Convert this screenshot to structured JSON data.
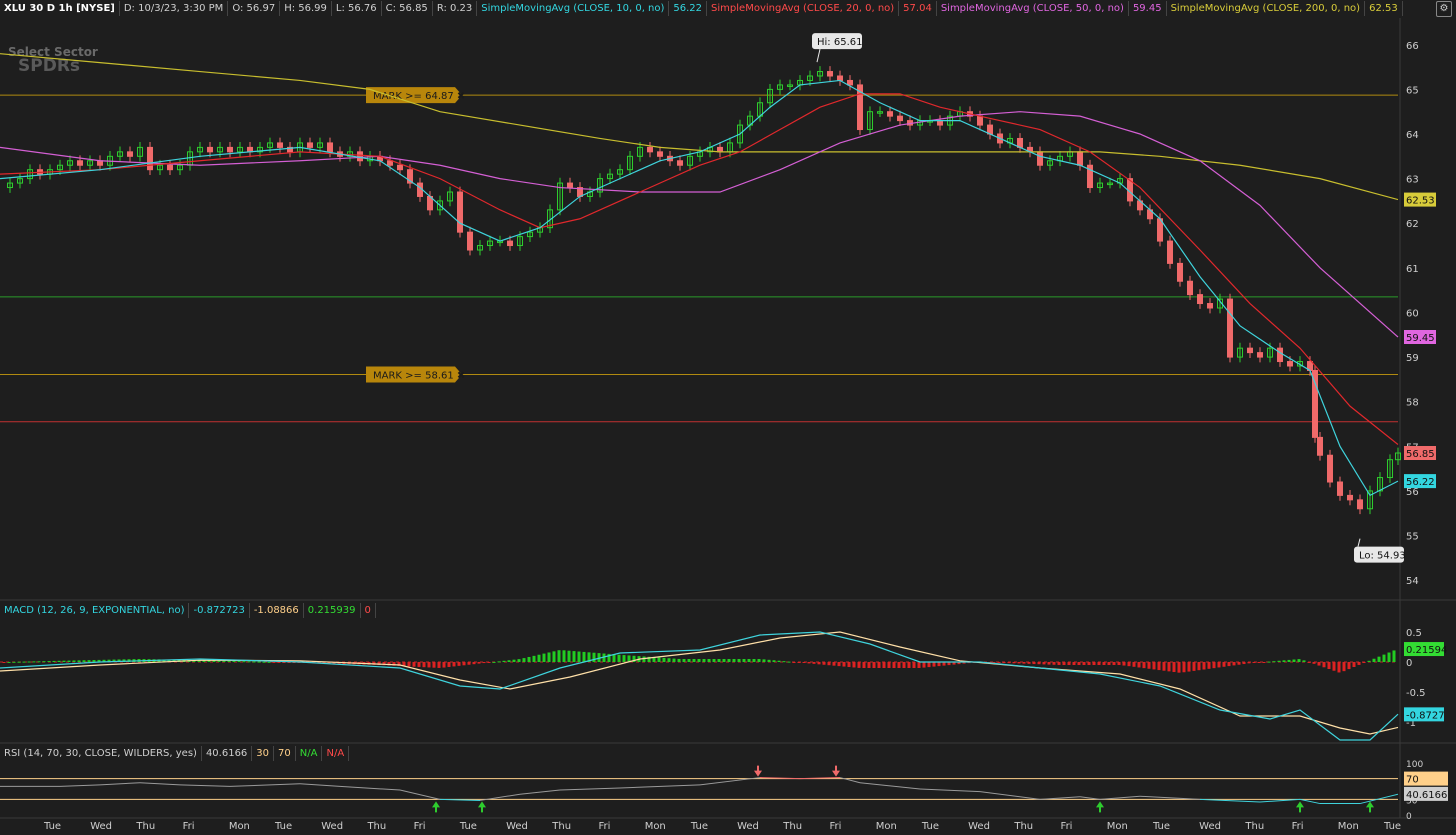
{
  "header": {
    "symbol": "XLU 30 D 1h [NYSE]",
    "date": "D: 10/3/23, 3:30 PM",
    "open": "O: 56.97",
    "high": "H: 56.99",
    "low": "L: 56.76",
    "close": "C: 56.85",
    "range": "R: 0.23",
    "sma10_label": "SimpleMovingAvg (CLOSE, 10, 0, no)",
    "sma10_value": "56.22",
    "sma20_label": "SimpleMovingAvg (CLOSE, 20, 0, no)",
    "sma20_value": "57.04",
    "sma50_label": "SimpleMovingAvg (CLOSE, 50, 0, no)",
    "sma50_value": "59.45",
    "sma200_label": "SimpleMovingAvg (CLOSE, 200, 0, no)",
    "sma200_value": "62.53"
  },
  "watermark": {
    "line1": "Select Sector",
    "line2": "SPDRs"
  },
  "marks": [
    {
      "label": "MARK >= 64.87 ✖",
      "price": 64.87
    },
    {
      "label": "MARK >= 58.61 ✖",
      "price": 58.61
    }
  ],
  "callouts": {
    "hi": "Hi: 65.61",
    "lo": "Lo: 54.93"
  },
  "macd_header": {
    "label": "MACD (12, 26, 9, EXPONENTIAL, no)",
    "value": "-0.872723",
    "avg": "-1.08866",
    "diff": "0.215939",
    "zero": "0"
  },
  "rsi_header": {
    "label": "RSI (14, 70, 30, CLOSE, WILDERS, yes)",
    "value": "40.6166",
    "os": "30",
    "ob": "70",
    "na1": "N/A",
    "na2": "N/A"
  },
  "colors": {
    "bg": "#1e1e1e",
    "up": "#2ecc2e",
    "down": "#f06a6a",
    "sma10": "#3fd3dc",
    "sma20": "#e0282c",
    "sma50": "#d45fd4",
    "sma200": "#c8be2e",
    "grid": "#2a2a2a"
  },
  "chart_data": {
    "type": "candlestick",
    "price_axis": {
      "range": [
        53.6,
        66.6
      ],
      "ticks": [
        54,
        55,
        56,
        57,
        58,
        59,
        60,
        61,
        62,
        63,
        64,
        65,
        66
      ]
    },
    "price_badges": [
      {
        "value": "62.53",
        "color": "#d8cc3a"
      },
      {
        "value": "59.45",
        "color": "#e066e0"
      },
      {
        "value": "56.85",
        "color": "#f06a6a"
      },
      {
        "value": "56.22",
        "color": "#33d6e0"
      }
    ],
    "horizontal_lines": [
      {
        "price": 60.35,
        "color": "#2a9a2a"
      },
      {
        "price": 57.55,
        "color": "#c03030"
      }
    ],
    "x_labels": [
      "Tue",
      "Wed",
      "Thu",
      "Fri",
      "Mon",
      "Tue",
      "Wed",
      "Thu",
      "Fri",
      "Tue",
      "Wed",
      "Thu",
      "Fri",
      "Mon",
      "Tue",
      "Wed",
      "Thu",
      "Fri",
      "Mon",
      "Tue",
      "Wed",
      "Thu",
      "Fri",
      "Mon",
      "Tue",
      "Wed",
      "Thu",
      "Fri",
      "Mon",
      "Tue"
    ],
    "close_path": [
      [
        0,
        62.8
      ],
      [
        10,
        62.9
      ],
      [
        20,
        63.0
      ],
      [
        30,
        63.2
      ],
      [
        40,
        63.1
      ],
      [
        50,
        63.2
      ],
      [
        60,
        63.3
      ],
      [
        70,
        63.4
      ],
      [
        80,
        63.3
      ],
      [
        90,
        63.4
      ],
      [
        100,
        63.3
      ],
      [
        110,
        63.5
      ],
      [
        120,
        63.6
      ],
      [
        130,
        63.5
      ],
      [
        140,
        63.7
      ],
      [
        150,
        63.2
      ],
      [
        160,
        63.3
      ],
      [
        170,
        63.2
      ],
      [
        180,
        63.3
      ],
      [
        190,
        63.6
      ],
      [
        200,
        63.7
      ],
      [
        210,
        63.6
      ],
      [
        220,
        63.7
      ],
      [
        230,
        63.6
      ],
      [
        240,
        63.7
      ],
      [
        250,
        63.6
      ],
      [
        260,
        63.7
      ],
      [
        270,
        63.8
      ],
      [
        280,
        63.7
      ],
      [
        290,
        63.6
      ],
      [
        300,
        63.8
      ],
      [
        310,
        63.7
      ],
      [
        320,
        63.8
      ],
      [
        330,
        63.6
      ],
      [
        340,
        63.5
      ],
      [
        350,
        63.6
      ],
      [
        360,
        63.4
      ],
      [
        370,
        63.5
      ],
      [
        380,
        63.4
      ],
      [
        390,
        63.3
      ],
      [
        400,
        63.2
      ],
      [
        410,
        62.9
      ],
      [
        420,
        62.6
      ],
      [
        430,
        62.3
      ],
      [
        440,
        62.5
      ],
      [
        450,
        62.7
      ],
      [
        460,
        61.8
      ],
      [
        470,
        61.4
      ],
      [
        480,
        61.5
      ],
      [
        490,
        61.6
      ],
      [
        500,
        61.6
      ],
      [
        510,
        61.5
      ],
      [
        520,
        61.7
      ],
      [
        530,
        61.8
      ],
      [
        540,
        61.9
      ],
      [
        550,
        62.3
      ],
      [
        560,
        62.9
      ],
      [
        570,
        62.8
      ],
      [
        580,
        62.6
      ],
      [
        590,
        62.7
      ],
      [
        600,
        63.0
      ],
      [
        610,
        63.1
      ],
      [
        620,
        63.2
      ],
      [
        630,
        63.5
      ],
      [
        640,
        63.7
      ],
      [
        650,
        63.6
      ],
      [
        660,
        63.5
      ],
      [
        670,
        63.4
      ],
      [
        680,
        63.3
      ],
      [
        690,
        63.5
      ],
      [
        700,
        63.6
      ],
      [
        710,
        63.7
      ],
      [
        720,
        63.6
      ],
      [
        730,
        63.8
      ],
      [
        740,
        64.2
      ],
      [
        750,
        64.4
      ],
      [
        760,
        64.7
      ],
      [
        770,
        65.0
      ],
      [
        780,
        65.1
      ],
      [
        790,
        65.1
      ],
      [
        800,
        65.2
      ],
      [
        810,
        65.3
      ],
      [
        820,
        65.4
      ],
      [
        830,
        65.3
      ],
      [
        840,
        65.2
      ],
      [
        850,
        65.1
      ],
      [
        860,
        64.1
      ],
      [
        870,
        64.5
      ],
      [
        880,
        64.5
      ],
      [
        890,
        64.4
      ],
      [
        900,
        64.3
      ],
      [
        910,
        64.2
      ],
      [
        920,
        64.3
      ],
      [
        930,
        64.3
      ],
      [
        940,
        64.2
      ],
      [
        950,
        64.4
      ],
      [
        960,
        64.5
      ],
      [
        970,
        64.4
      ],
      [
        980,
        64.2
      ],
      [
        990,
        64.0
      ],
      [
        1000,
        63.8
      ],
      [
        1010,
        63.9
      ],
      [
        1020,
        63.7
      ],
      [
        1030,
        63.6
      ],
      [
        1040,
        63.3
      ],
      [
        1050,
        63.4
      ],
      [
        1060,
        63.5
      ],
      [
        1070,
        63.6
      ],
      [
        1080,
        63.3
      ],
      [
        1090,
        62.8
      ],
      [
        1100,
        62.9
      ],
      [
        1110,
        62.9
      ],
      [
        1120,
        63.0
      ],
      [
        1130,
        62.5
      ],
      [
        1140,
        62.3
      ],
      [
        1150,
        62.1
      ],
      [
        1160,
        61.6
      ],
      [
        1170,
        61.1
      ],
      [
        1180,
        60.7
      ],
      [
        1190,
        60.4
      ],
      [
        1200,
        60.2
      ],
      [
        1210,
        60.1
      ],
      [
        1220,
        60.3
      ],
      [
        1230,
        59.0
      ],
      [
        1240,
        59.2
      ],
      [
        1250,
        59.1
      ],
      [
        1260,
        59.0
      ],
      [
        1270,
        59.2
      ],
      [
        1280,
        58.9
      ],
      [
        1290,
        58.8
      ],
      [
        1300,
        58.9
      ],
      [
        1310,
        58.7
      ],
      [
        1315,
        57.2
      ],
      [
        1320,
        56.8
      ],
      [
        1330,
        56.2
      ],
      [
        1340,
        55.9
      ],
      [
        1350,
        55.8
      ],
      [
        1360,
        55.6
      ],
      [
        1370,
        56.0
      ],
      [
        1380,
        56.3
      ],
      [
        1390,
        56.7
      ],
      [
        1398,
        56.85
      ]
    ],
    "sma10": [
      [
        0,
        63.0
      ],
      [
        100,
        63.2
      ],
      [
        200,
        63.5
      ],
      [
        300,
        63.7
      ],
      [
        380,
        63.4
      ],
      [
        420,
        62.8
      ],
      [
        460,
        62.0
      ],
      [
        500,
        61.6
      ],
      [
        540,
        61.9
      ],
      [
        580,
        62.6
      ],
      [
        620,
        63.0
      ],
      [
        660,
        63.4
      ],
      [
        700,
        63.6
      ],
      [
        740,
        64.0
      ],
      [
        770,
        64.6
      ],
      [
        800,
        65.1
      ],
      [
        840,
        65.2
      ],
      [
        880,
        64.7
      ],
      [
        920,
        64.3
      ],
      [
        960,
        64.3
      ],
      [
        1000,
        63.9
      ],
      [
        1040,
        63.5
      ],
      [
        1080,
        63.3
      ],
      [
        1120,
        62.9
      ],
      [
        1160,
        62.1
      ],
      [
        1200,
        60.8
      ],
      [
        1240,
        59.7
      ],
      [
        1280,
        59.1
      ],
      [
        1310,
        58.7
      ],
      [
        1340,
        57.0
      ],
      [
        1370,
        55.9
      ],
      [
        1398,
        56.22
      ]
    ],
    "sma20": [
      [
        0,
        63.1
      ],
      [
        100,
        63.2
      ],
      [
        200,
        63.4
      ],
      [
        300,
        63.6
      ],
      [
        380,
        63.5
      ],
      [
        440,
        63.0
      ],
      [
        500,
        62.3
      ],
      [
        540,
        61.9
      ],
      [
        580,
        62.1
      ],
      [
        640,
        62.7
      ],
      [
        700,
        63.3
      ],
      [
        740,
        63.6
      ],
      [
        780,
        64.1
      ],
      [
        820,
        64.6
      ],
      [
        860,
        64.9
      ],
      [
        900,
        64.9
      ],
      [
        940,
        64.6
      ],
      [
        980,
        64.4
      ],
      [
        1040,
        64.1
      ],
      [
        1090,
        63.6
      ],
      [
        1140,
        62.8
      ],
      [
        1200,
        61.4
      ],
      [
        1250,
        60.2
      ],
      [
        1300,
        59.2
      ],
      [
        1350,
        57.9
      ],
      [
        1398,
        57.04
      ]
    ],
    "sma50": [
      [
        0,
        63.7
      ],
      [
        100,
        63.4
      ],
      [
        200,
        63.3
      ],
      [
        300,
        63.4
      ],
      [
        380,
        63.5
      ],
      [
        440,
        63.3
      ],
      [
        500,
        63.0
      ],
      [
        560,
        62.8
      ],
      [
        640,
        62.7
      ],
      [
        720,
        62.7
      ],
      [
        780,
        63.2
      ],
      [
        840,
        63.8
      ],
      [
        900,
        64.2
      ],
      [
        960,
        64.4
      ],
      [
        1020,
        64.5
      ],
      [
        1080,
        64.4
      ],
      [
        1140,
        64.0
      ],
      [
        1200,
        63.4
      ],
      [
        1260,
        62.4
      ],
      [
        1320,
        61.0
      ],
      [
        1398,
        59.45
      ]
    ],
    "sma200": [
      [
        0,
        65.8
      ],
      [
        100,
        65.6
      ],
      [
        200,
        65.4
      ],
      [
        300,
        65.2
      ],
      [
        370,
        65.0
      ],
      [
        440,
        64.5
      ],
      [
        520,
        64.2
      ],
      [
        600,
        63.9
      ],
      [
        660,
        63.7
      ],
      [
        720,
        63.6
      ],
      [
        800,
        63.6
      ],
      [
        880,
        63.6
      ],
      [
        960,
        63.6
      ],
      [
        1040,
        63.6
      ],
      [
        1100,
        63.6
      ],
      [
        1160,
        63.5
      ],
      [
        1240,
        63.3
      ],
      [
        1320,
        63.0
      ],
      [
        1398,
        62.53
      ]
    ],
    "macd": {
      "range": [
        -1.3,
        0.7
      ],
      "ticks": [
        0.5,
        0,
        -0.5,
        -1
      ],
      "badges": [
        {
          "value": "0.21594",
          "color": "#33dd33"
        },
        {
          "value": "-0.8727",
          "color": "#33d6e0"
        }
      ],
      "value_line": [
        [
          0,
          -0.1
        ],
        [
          100,
          0.0
        ],
        [
          200,
          0.05
        ],
        [
          300,
          0.0
        ],
        [
          400,
          -0.1
        ],
        [
          460,
          -0.4
        ],
        [
          500,
          -0.45
        ],
        [
          560,
          -0.1
        ],
        [
          620,
          0.15
        ],
        [
          700,
          0.2
        ],
        [
          760,
          0.45
        ],
        [
          820,
          0.5
        ],
        [
          870,
          0.3
        ],
        [
          920,
          0.0
        ],
        [
          980,
          0.0
        ],
        [
          1040,
          -0.1
        ],
        [
          1100,
          -0.2
        ],
        [
          1160,
          -0.4
        ],
        [
          1220,
          -0.8
        ],
        [
          1270,
          -0.95
        ],
        [
          1300,
          -0.8
        ],
        [
          1340,
          -1.3
        ],
        [
          1370,
          -1.3
        ],
        [
          1398,
          -0.87
        ]
      ],
      "avg_line": [
        [
          0,
          -0.15
        ],
        [
          100,
          -0.05
        ],
        [
          200,
          0.03
        ],
        [
          300,
          0.02
        ],
        [
          400,
          -0.05
        ],
        [
          460,
          -0.3
        ],
        [
          510,
          -0.45
        ],
        [
          570,
          -0.25
        ],
        [
          640,
          0.05
        ],
        [
          720,
          0.2
        ],
        [
          780,
          0.4
        ],
        [
          840,
          0.5
        ],
        [
          900,
          0.25
        ],
        [
          960,
          0.02
        ],
        [
          1040,
          -0.1
        ],
        [
          1120,
          -0.2
        ],
        [
          1180,
          -0.45
        ],
        [
          1240,
          -0.9
        ],
        [
          1300,
          -0.9
        ],
        [
          1340,
          -1.1
        ],
        [
          1370,
          -1.2
        ],
        [
          1398,
          -1.09
        ]
      ],
      "hist": [
        [
          60,
          0.02
        ],
        [
          140,
          0.05
        ],
        [
          230,
          0.02
        ],
        [
          380,
          -0.05
        ],
        [
          440,
          -0.1
        ],
        [
          520,
          0.05
        ],
        [
          560,
          0.2
        ],
        [
          620,
          0.12
        ],
        [
          680,
          0.05
        ],
        [
          760,
          0.05
        ],
        [
          860,
          -0.1
        ],
        [
          920,
          -0.1
        ],
        [
          980,
          0.0
        ],
        [
          1060,
          -0.05
        ],
        [
          1120,
          -0.05
        ],
        [
          1180,
          -0.18
        ],
        [
          1250,
          -0.02
        ],
        [
          1300,
          0.05
        ],
        [
          1340,
          -0.18
        ],
        [
          1398,
          0.22
        ]
      ]
    },
    "rsi": {
      "range": [
        0,
        100
      ],
      "ticks": [
        100,
        70,
        30,
        0
      ],
      "badges": [
        {
          "value": "70",
          "color": "#ffd08a"
        },
        {
          "value": "40.6166",
          "color": "#cfcfcf"
        }
      ],
      "line": [
        [
          0,
          55
        ],
        [
          60,
          55
        ],
        [
          100,
          58
        ],
        [
          140,
          62
        ],
        [
          180,
          58
        ],
        [
          230,
          55
        ],
        [
          300,
          60
        ],
        [
          340,
          55
        ],
        [
          400,
          48
        ],
        [
          440,
          30
        ],
        [
          480,
          28
        ],
        [
          520,
          40
        ],
        [
          560,
          48
        ],
        [
          620,
          52
        ],
        [
          700,
          58
        ],
        [
          760,
          72
        ],
        [
          800,
          70
        ],
        [
          840,
          72
        ],
        [
          860,
          62
        ],
        [
          920,
          50
        ],
        [
          980,
          45
        ],
        [
          1040,
          30
        ],
        [
          1080,
          35
        ],
        [
          1100,
          30
        ],
        [
          1140,
          36
        ],
        [
          1200,
          30
        ],
        [
          1260,
          25
        ],
        [
          1300,
          30
        ],
        [
          1320,
          22
        ],
        [
          1360,
          22
        ],
        [
          1398,
          40
        ]
      ],
      "buy_arrows": [
        436,
        482,
        1100,
        1300,
        1370
      ],
      "sell_arrows": [
        758,
        836
      ]
    }
  }
}
